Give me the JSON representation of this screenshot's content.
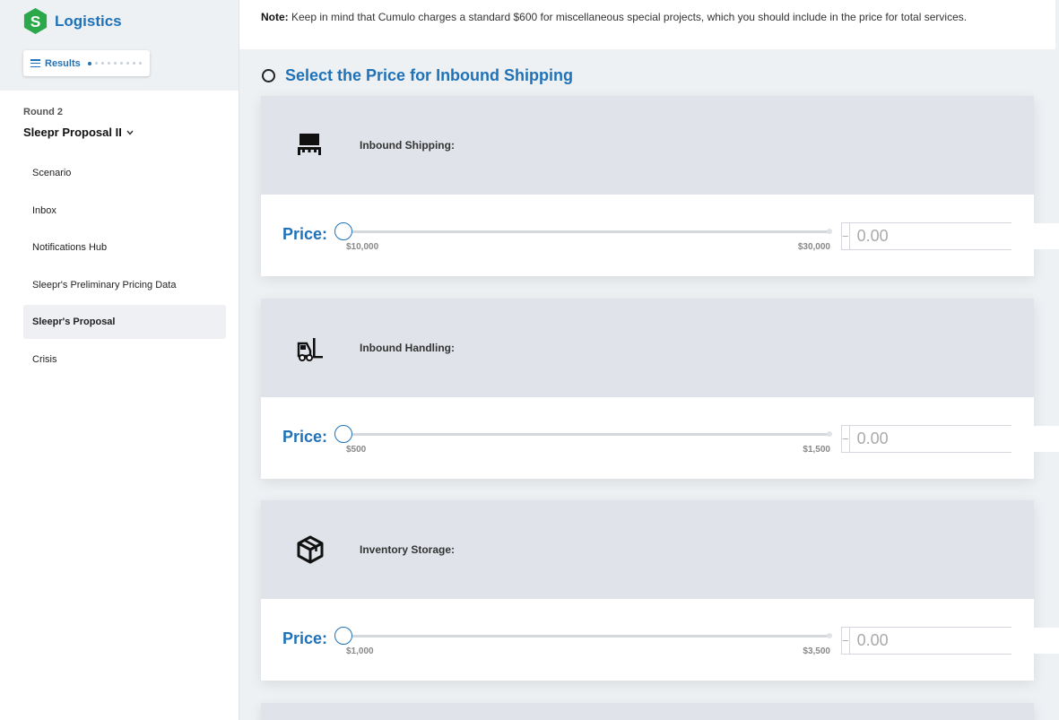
{
  "brand": {
    "name": "Logistics",
    "logo_letter": "S",
    "color": "#1f72b8",
    "logo_color": "#2aa84a"
  },
  "results_button": {
    "label": "Results",
    "dots_total": 9,
    "active_dot": 0
  },
  "round": {
    "label": "Round 2"
  },
  "proposal": {
    "name": "Sleepr Proposal II"
  },
  "nav": {
    "items": [
      {
        "label": "Scenario"
      },
      {
        "label": "Inbox"
      },
      {
        "label": "Notifications Hub"
      },
      {
        "label": "Sleepr's Preliminary Pricing Data"
      },
      {
        "label": "Sleepr's Proposal",
        "active": true
      },
      {
        "label": "Crisis"
      }
    ]
  },
  "note": {
    "prefix": "Note:",
    "text": " Keep in mind that Cumulo charges a standard $600 for miscellaneous special projects, which you should include in the price for total services."
  },
  "section": {
    "title": "Select the Price for Inbound Shipping"
  },
  "price_cards": [
    {
      "icon": "truck-icon",
      "label": "Inbound Shipping:",
      "price_label": "Price:",
      "min": "$10,000",
      "max": "$30,000",
      "value": 0,
      "placeholder": "0.00"
    },
    {
      "icon": "forklift-icon",
      "label": "Inbound Handling:",
      "price_label": "Price:",
      "min": "$500",
      "max": "$1,500",
      "value": 0,
      "placeholder": "0.00"
    },
    {
      "icon": "box-icon",
      "label": "Inventory Storage:",
      "price_label": "Price:",
      "min": "$1,000",
      "max": "$3,500",
      "value": 0,
      "placeholder": "0.00"
    }
  ],
  "stepper": {
    "minus": "−",
    "plus": "+"
  }
}
